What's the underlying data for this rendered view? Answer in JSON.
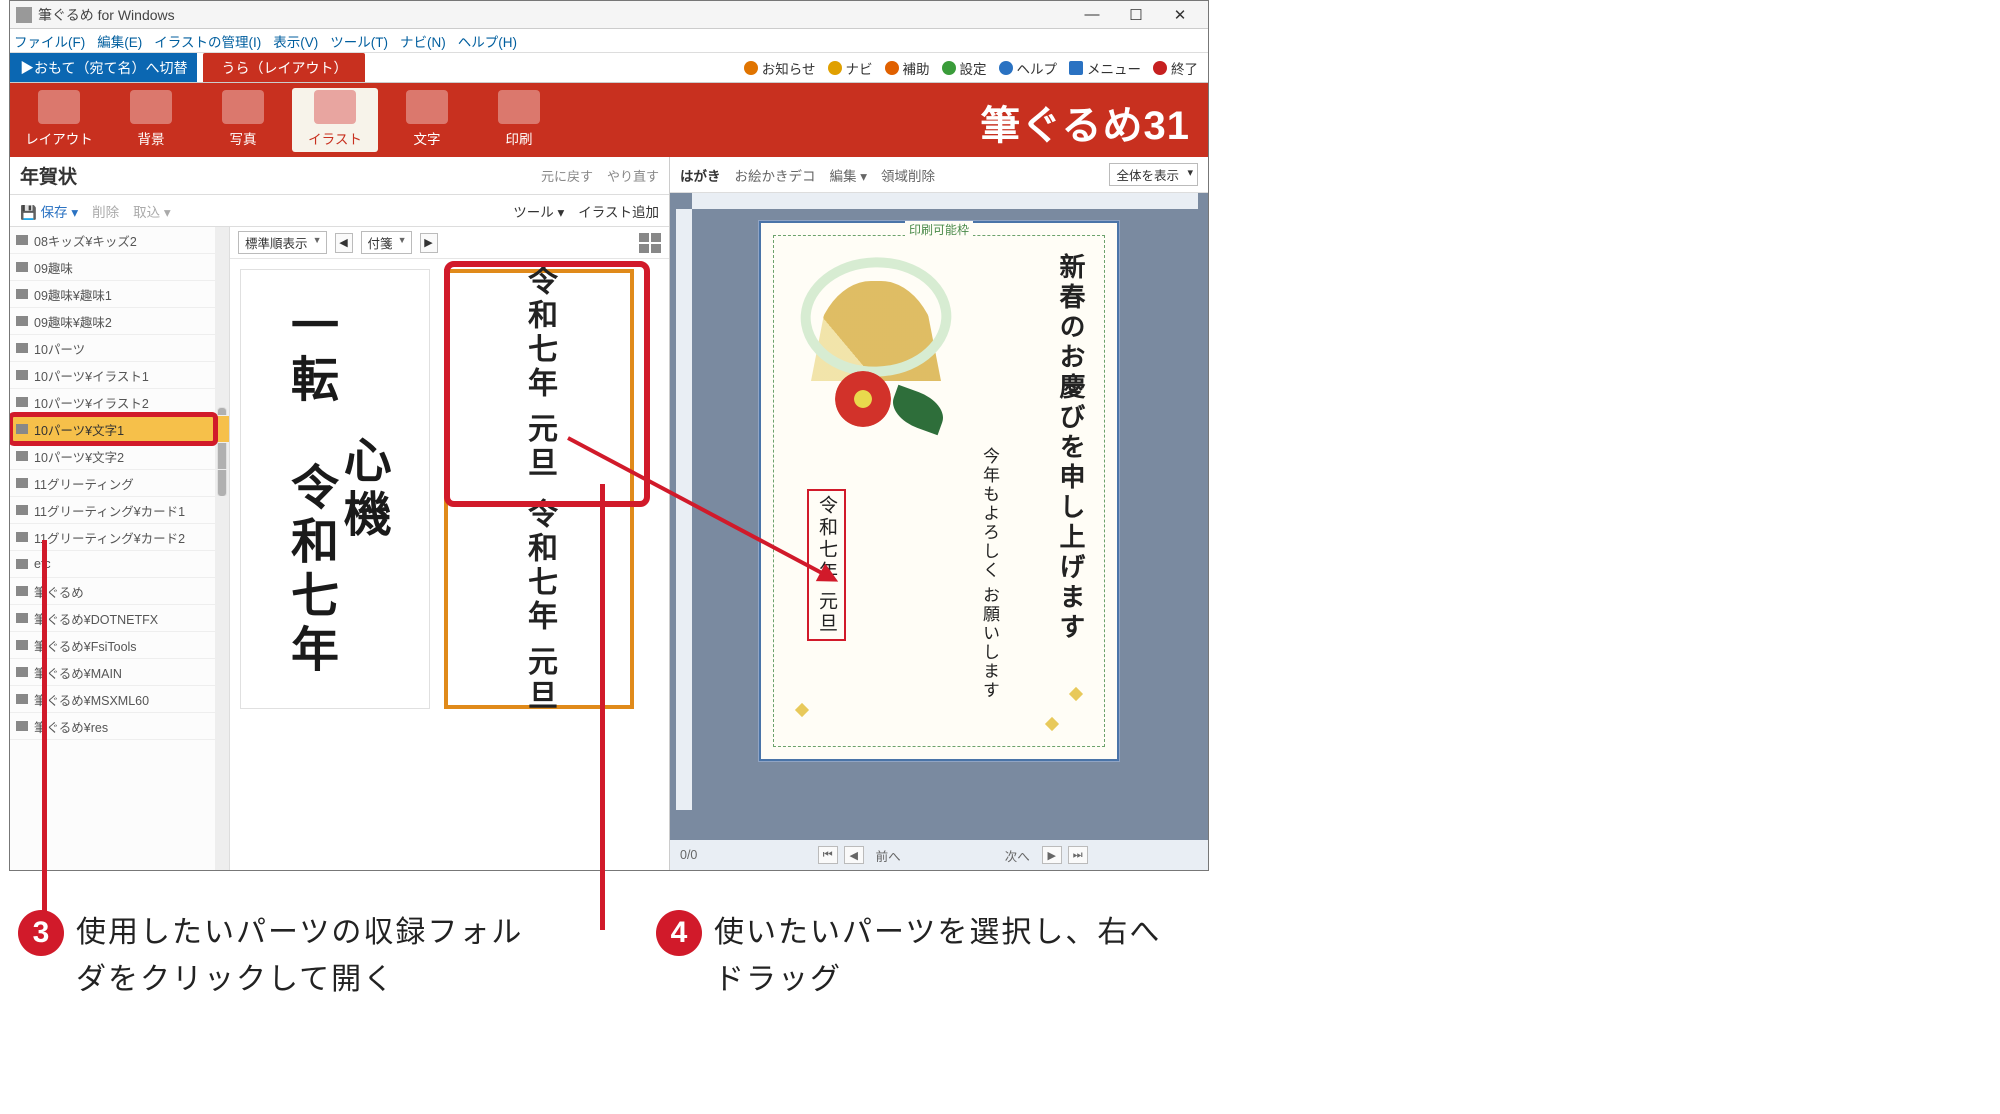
{
  "window": {
    "title": "筆ぐるめ for Windows"
  },
  "menubar": {
    "file": "ファイル(F)",
    "edit": "編集(E)",
    "illust_mgmt": "イラストの管理(I)",
    "view": "表示(V)",
    "tool": "ツール(T)",
    "navi": "ナビ(N)",
    "help": "ヘルプ(H)"
  },
  "toprow": {
    "switch_front": "▶おもて（宛て名）へ切替",
    "tab_back": "うら（レイアウト）",
    "oshirase": "お知らせ",
    "navi": "ナビ",
    "hojo": "補助",
    "settei": "設定",
    "help": "ヘルプ",
    "menu": "メニュー",
    "exit": "終了"
  },
  "ribbon": {
    "layout": "レイアウト",
    "haikei": "背景",
    "shashin": "写真",
    "illust": "イラスト",
    "moji": "文字",
    "insatsu": "印刷",
    "brand": "筆ぐるめ31"
  },
  "left": {
    "title": "年賀状",
    "undo": "元に戻す",
    "redo": "やり直す",
    "save": "保存",
    "delete": "削除",
    "import": "取込",
    "tool": "ツール",
    "add_illust": "イラスト追加",
    "sort_label": "標準順表示",
    "nav_label": "付箋",
    "folders": [
      "08キッズ¥キッズ2",
      "09趣味",
      "09趣味¥趣味1",
      "09趣味¥趣味2",
      "10パーツ",
      "10パーツ¥イラスト1",
      "10パーツ¥イラスト2",
      "10パーツ¥文字1",
      "10パーツ¥文字2",
      "11グリーティング",
      "11グリーティング¥カード1",
      "11グリーティング¥カード2",
      "etc",
      "筆ぐるめ",
      "筆ぐるめ¥DOTNETFX",
      "筆ぐるめ¥FsiTools",
      "筆ぐるめ¥MAIN",
      "筆ぐるめ¥MSXML60",
      "筆ぐるめ¥res"
    ],
    "selected_folder_index": 7,
    "thumb1_line1": "心機",
    "thumb1_line2": "一転",
    "thumb1_line3": "令和七年",
    "thumb2_line1": "令和七年 元旦",
    "thumb2_line2": "令和七年 元旦"
  },
  "right": {
    "label": "はがき",
    "oekaki": "お絵かきデコ",
    "henshu": "編集",
    "ryoiki": "領域削除",
    "zoom_label": "全体を表示",
    "print_frame": "印刷可能枠",
    "greeting_main": "新春のお慶びを申し上げます",
    "greeting_sub": "今年もよろしく\nお願いします",
    "greeting_date": "令和七年 元旦",
    "page_count": "0/0",
    "prev": "前へ",
    "next": "次へ"
  },
  "callouts": {
    "c3": "使用したいパーツの収録フォルダをクリックして開く",
    "c4": "使いたいパーツを選択し、右へドラッグ"
  }
}
